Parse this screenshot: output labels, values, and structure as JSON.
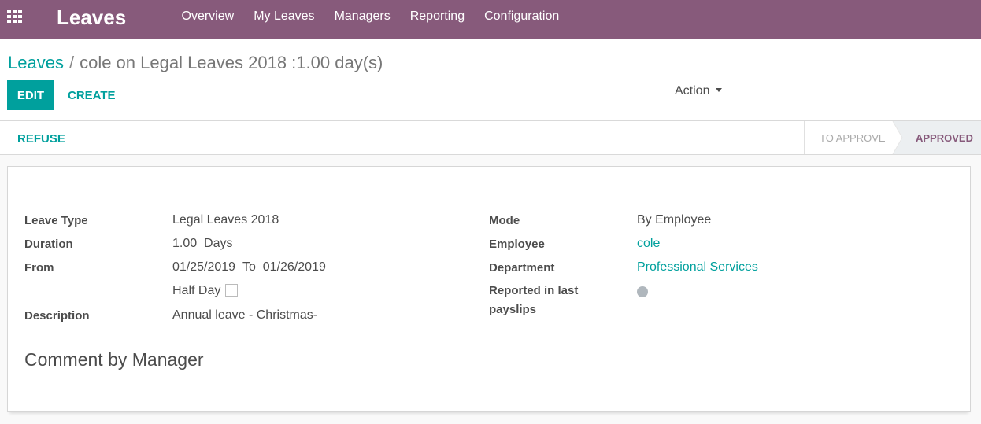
{
  "navbar": {
    "app_title": "Leaves",
    "items": [
      {
        "label": "Overview"
      },
      {
        "label": "My Leaves"
      },
      {
        "label": "Managers"
      },
      {
        "label": "Reporting"
      },
      {
        "label": "Configuration"
      }
    ],
    "color": "#875a7b"
  },
  "breadcrumb": {
    "parent": "Leaves",
    "separator": "/",
    "current": "cole on Legal Leaves 2018 :1.00 day(s)"
  },
  "buttons": {
    "edit": "EDIT",
    "create": "CREATE",
    "action": "Action",
    "refuse": "REFUSE"
  },
  "statusbar": {
    "stages": [
      {
        "label": "TO APPROVE",
        "active": false
      },
      {
        "label": "APPROVED",
        "active": true
      }
    ]
  },
  "form": {
    "left": {
      "leave_type": {
        "label": "Leave Type",
        "value": "Legal Leaves 2018"
      },
      "duration": {
        "label": "Duration",
        "value": "1.00",
        "unit": "Days"
      },
      "from": {
        "label": "From",
        "start": "01/25/2019",
        "to_word": "To",
        "end": "01/26/2019"
      },
      "half_day": {
        "label": "Half Day",
        "checked": false
      },
      "description": {
        "label": "Description",
        "value": "Annual leave - Christmas-"
      }
    },
    "right": {
      "mode": {
        "label": "Mode",
        "value": "By Employee"
      },
      "employee": {
        "label": "Employee",
        "value": "cole"
      },
      "department": {
        "label": "Department",
        "value": "Professional Services"
      },
      "reported": {
        "label_line1": "Reported in last",
        "label_line2": "payslips",
        "value": false
      }
    },
    "comment_section": "Comment by Manager"
  },
  "colors": {
    "accent": "#00a09d",
    "brand": "#875a7b"
  }
}
